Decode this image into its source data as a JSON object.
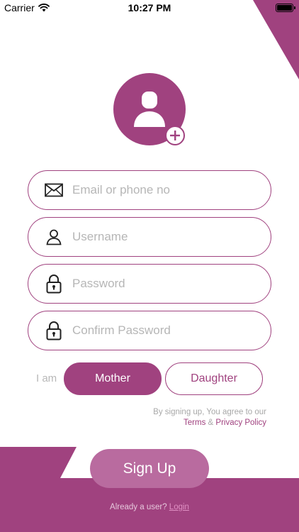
{
  "status_bar": {
    "carrier": "Carrier",
    "time": "10:27 PM"
  },
  "form": {
    "email_placeholder": "Email or phone no",
    "username_placeholder": "Username",
    "password_placeholder": "Password",
    "confirm_password_placeholder": "Confirm Password"
  },
  "role": {
    "label": "I am",
    "options": [
      "Mother",
      "Daughter"
    ],
    "selected": "Mother"
  },
  "terms": {
    "line1": "By signing up, You agree to our",
    "terms_link": "Terms",
    "ampersand": "&",
    "privacy_link": "Privacy Policy"
  },
  "signup_button": "Sign Up",
  "footer": {
    "prompt": "Already a user?",
    "login_link": "Login"
  },
  "colors": {
    "primary": "#a0427f",
    "button": "#b96b9f",
    "placeholder": "#b6b6b6"
  },
  "icons": [
    "wifi-icon",
    "battery-icon",
    "user-silhouette-icon",
    "plus-icon",
    "envelope-icon",
    "person-icon",
    "lock-icon"
  ]
}
